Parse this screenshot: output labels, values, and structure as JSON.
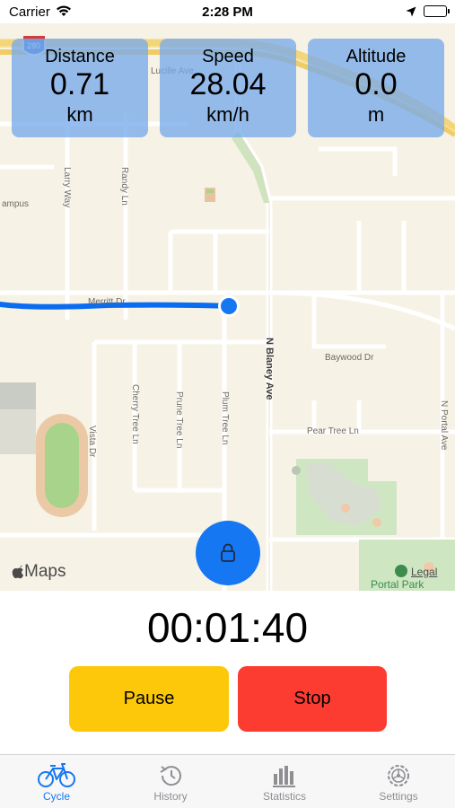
{
  "status_bar": {
    "carrier": "Carrier",
    "time": "2:28 PM",
    "icons": [
      "wifi-icon",
      "location-arrow-icon",
      "battery-icon"
    ]
  },
  "map": {
    "highway_shield": "280",
    "streets": {
      "lucille": "Lucille Ave",
      "campus": "ampus",
      "larry_way": "Larry Way",
      "randy_ln": "Randy Ln",
      "merritt": "Merritt Dr",
      "n_blaney": "N Blaney Ave",
      "baywood": "Baywood Dr",
      "cherry_tree": "Cherry Tree Ln",
      "prune_tree": "Prune Tree Ln",
      "plum_tree": "Plum Tree Ln",
      "vista": "Vista Dr",
      "pear_tree": "Pear Tree Ln",
      "n_portal": "N Portal Ave"
    },
    "attribution": "Maps",
    "legal": "Legal",
    "park": "Portal Park",
    "colors": {
      "route": "#0a6cf0",
      "lock_button": "#1677f2",
      "background": "#f7f2e6"
    }
  },
  "stats": {
    "distance": {
      "title": "Distance",
      "value": "0.71",
      "unit": "km"
    },
    "speed": {
      "title": "Speed",
      "value": "28.04",
      "unit": "km/h"
    },
    "altitude": {
      "title": "Altitude",
      "value": "0.0",
      "unit": "m"
    }
  },
  "timer": "00:01:40",
  "actions": {
    "pause": "Pause",
    "stop": "Stop",
    "colors": {
      "pause": "#fdc80a",
      "stop": "#fc3c31"
    }
  },
  "tabs": [
    {
      "label": "Cycle",
      "icon": "bicycle-icon",
      "active": true
    },
    {
      "label": "History",
      "icon": "history-icon",
      "active": false
    },
    {
      "label": "Statistics",
      "icon": "statistics-icon",
      "active": false
    },
    {
      "label": "Settings",
      "icon": "settings-icon",
      "active": false
    }
  ]
}
